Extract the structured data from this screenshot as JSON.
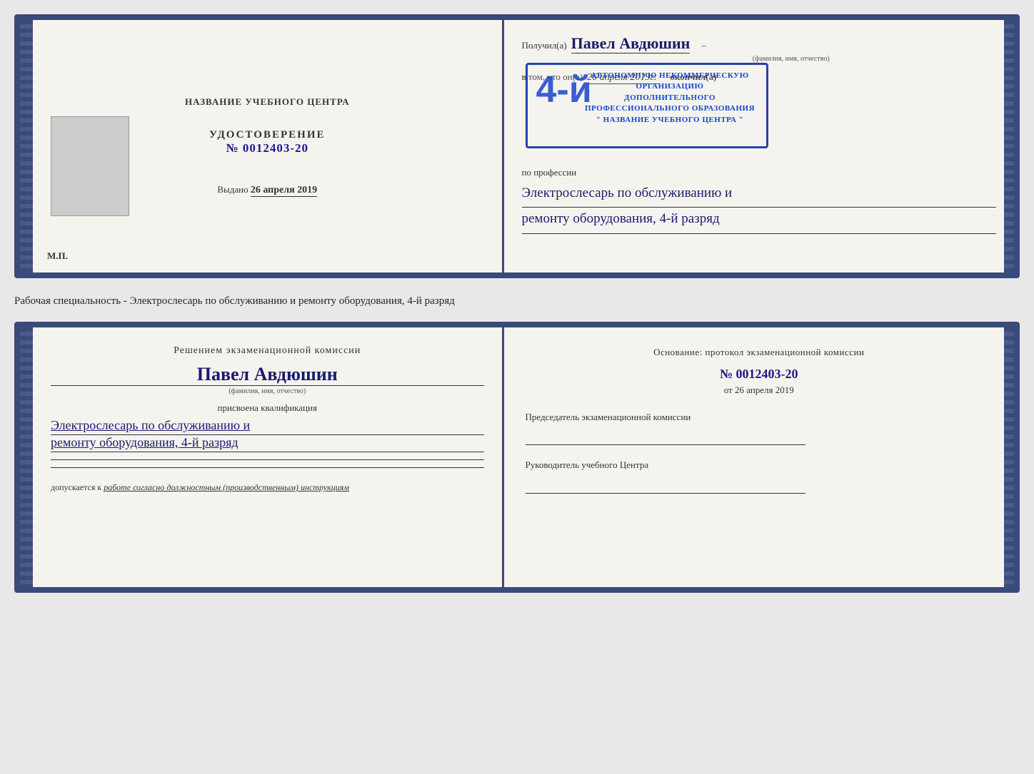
{
  "top_doc": {
    "left": {
      "center_title": "НАЗВАНИЕ УЧЕБНОГО ЦЕНТРА",
      "udostoverenie_label": "УДОСТОВЕРЕНИЕ",
      "udostoverenie_number": "№ 0012403-20",
      "vydano_prefix": "Выдано",
      "vydano_date": "26 апреля 2019",
      "mp_label": "М.П."
    },
    "right": {
      "poluchil_prefix": "Получил(а)",
      "poluchil_name": "Павел Авдюшин",
      "fio_label": "(фамилия, имя, отчество)",
      "vtom_prefix": "в том, что он(а)",
      "vtom_date": "26 апреля 2019г.",
      "okonchil_label": "окончил(а)",
      "grade": "4-й",
      "stamp_line1": "АВТОНОМНУЮ НЕКОММЕРЧЕСКУЮ ОРГАНИЗАЦИЮ",
      "stamp_line2": "ДОПОЛНИТЕЛЬНОГО ПРОФЕССИОНАЛЬНОГО ОБРАЗОВАНИЯ",
      "stamp_line3": "\" НАЗВАНИЕ УЧЕБНОГО ЦЕНТРА \"",
      "po_professii_label": "по профессии",
      "profession_line1": "Электрослесарь по обслуживанию и",
      "profession_line2": "ремонту оборудования, 4-й разряд"
    }
  },
  "description": {
    "text": "Рабочая специальность - Электрослесарь по обслуживанию и ремонту оборудования, 4-й разряд"
  },
  "bottom_doc": {
    "left": {
      "resheniyem_title": "Решением экзаменационной комиссии",
      "name": "Павел Авдюшин",
      "fio_label": "(фамилия, имя, отчество)",
      "prisvoena_label": "присвоена квалификация",
      "qual_line1": "Электрослесарь по обслуживанию и",
      "qual_line2": "ремонту оборудования, 4-й разряд",
      "dopuskaetsya_prefix": "допускается к",
      "dopuskaetsya_text": "работе согласно должностным (производственным) инструкциям"
    },
    "right": {
      "osnovanie_label": "Основание: протокол экзаменационной комиссии",
      "number": "№  0012403-20",
      "ot_prefix": "от",
      "ot_date": "26 апреля 2019",
      "predsedatel_label": "Председатель экзаменационной комиссии",
      "rukovoditel_label": "Руководитель учебного Центра"
    }
  }
}
